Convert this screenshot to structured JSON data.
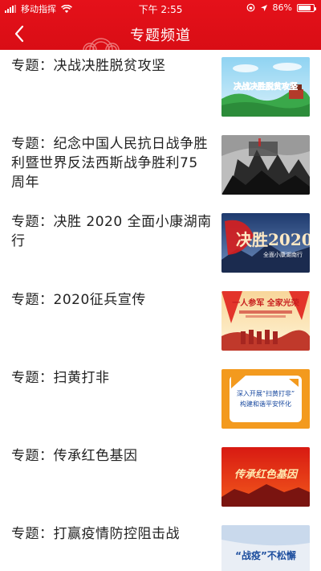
{
  "status_bar": {
    "carrier": "移动指挥",
    "time": "下午 2:55",
    "battery": "86%",
    "battery_level": 0.86
  },
  "nav": {
    "title": "专题频道",
    "back_icon": "chevron-left-icon"
  },
  "topics": [
    {
      "label": "专题：决战决胜脱贫攻坚",
      "thumb_text": "决战决胜脱贫攻坚"
    },
    {
      "label": "专题：纪念中国人民抗日战争胜利暨世界反法西斯战争胜利75周年",
      "thumb_text": ""
    },
    {
      "label": "专题：决胜 2020 全面小康湖南行",
      "thumb_text": "决胜2020",
      "thumb_sub": "全面小康湖南行"
    },
    {
      "label": "专题：2020征兵宣传",
      "thumb_text": "一人参军 全家光荣"
    },
    {
      "label": "专题：扫黄打非",
      "thumb_text": "深入开展“扫黄打非”",
      "thumb_sub": "构建和谐平安怀化"
    },
    {
      "label": "专题：传承红色基因",
      "thumb_text": "传承红色基因"
    },
    {
      "label": "专题：打赢疫情防控阻击战",
      "thumb_text": "“战疫”不松懈"
    }
  ],
  "colors": {
    "header_red": "#e0101a",
    "text": "#222222"
  }
}
